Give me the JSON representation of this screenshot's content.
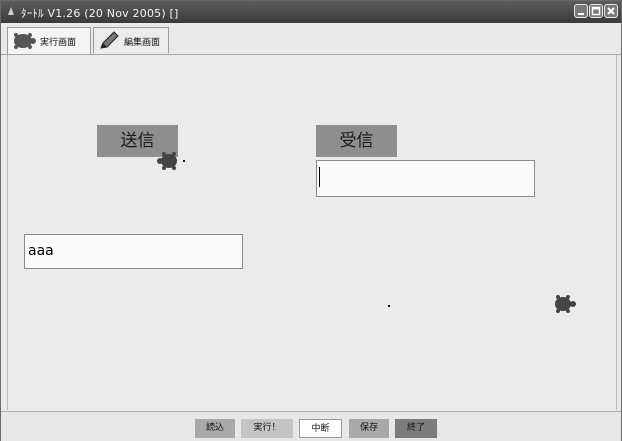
{
  "window": {
    "title": "ﾀｰﾄﾙ V1.26 (20 Nov 2005)  []"
  },
  "tabs": [
    {
      "label": "実行画面",
      "icon": "turtle-icon",
      "active": true
    },
    {
      "label": "編集画面",
      "icon": "pencil-icon",
      "active": false
    }
  ],
  "main": {
    "send_label": "送信",
    "receive_label": "受信",
    "receive_field": {
      "value": ""
    },
    "text_field": {
      "value": "aaa"
    }
  },
  "toolbar": {
    "buttons": [
      {
        "label": "読込"
      },
      {
        "label": "実行！"
      },
      {
        "label": "中断"
      },
      {
        "label": "保存"
      },
      {
        "label": "終了"
      }
    ]
  },
  "colors": {
    "titlebar": "#4a4a4a",
    "button_gray": "#8e8e8e",
    "background": "#ebebeb"
  }
}
